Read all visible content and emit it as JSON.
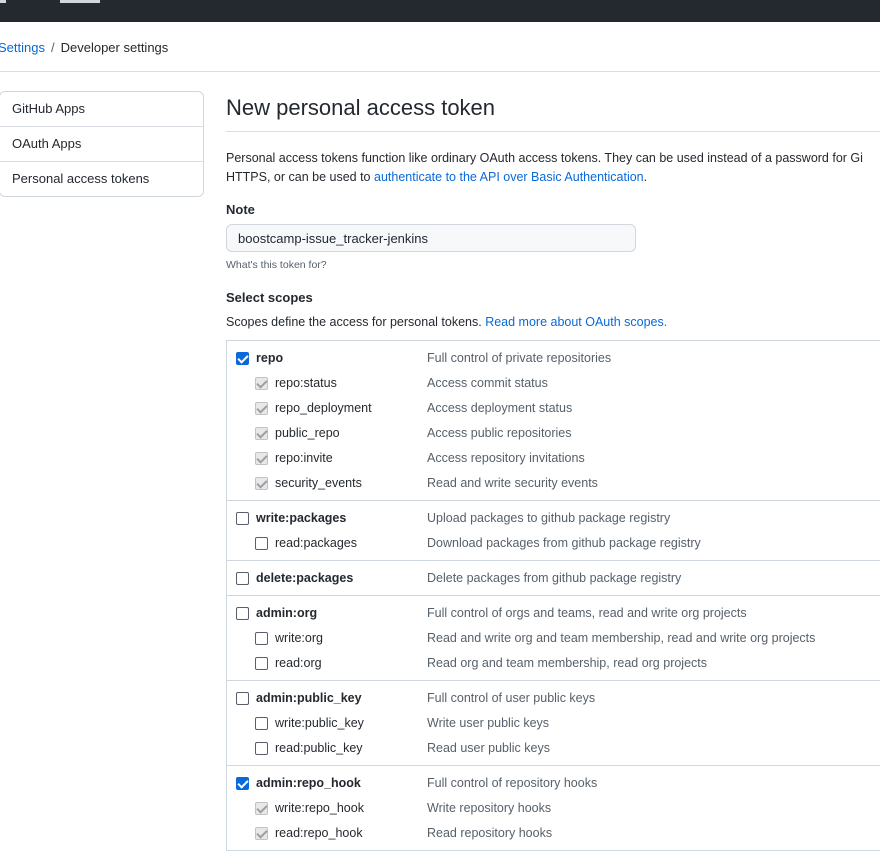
{
  "breadcrumb": {
    "parent": "Settings",
    "separator": "/",
    "current": "Developer settings"
  },
  "sidebar": {
    "items": [
      {
        "label": "GitHub Apps"
      },
      {
        "label": "OAuth Apps"
      },
      {
        "label": "Personal access tokens"
      }
    ]
  },
  "page": {
    "title": "New personal access token"
  },
  "intro": {
    "line1": "Personal access tokens function like ordinary OAuth access tokens. They can be used instead of a password for Gi",
    "line2_prefix": "HTTPS, or can be used to ",
    "line2_link": "authenticate to the API over Basic Authentication",
    "line2_suffix": "."
  },
  "note": {
    "label": "Note",
    "value": "boostcamp-issue_tracker-jenkins",
    "hint": "What's this token for?"
  },
  "scopes": {
    "label": "Select scopes",
    "description_prefix": "Scopes define the access for personal tokens. ",
    "description_link": "Read more about OAuth scopes.",
    "groups": [
      {
        "name": "repo",
        "description": "Full control of private repositories",
        "checked": true,
        "children": [
          {
            "name": "repo:status",
            "description": "Access commit status",
            "checked": true,
            "disabled": true
          },
          {
            "name": "repo_deployment",
            "description": "Access deployment status",
            "checked": true,
            "disabled": true
          },
          {
            "name": "public_repo",
            "description": "Access public repositories",
            "checked": true,
            "disabled": true
          },
          {
            "name": "repo:invite",
            "description": "Access repository invitations",
            "checked": true,
            "disabled": true
          },
          {
            "name": "security_events",
            "description": "Read and write security events",
            "checked": true,
            "disabled": true
          }
        ]
      },
      {
        "name": "write:packages",
        "description": "Upload packages to github package registry",
        "checked": false,
        "children": [
          {
            "name": "read:packages",
            "description": "Download packages from github package registry",
            "checked": false,
            "disabled": false
          }
        ]
      },
      {
        "name": "delete:packages",
        "description": "Delete packages from github package registry",
        "checked": false,
        "children": []
      },
      {
        "name": "admin:org",
        "description": "Full control of orgs and teams, read and write org projects",
        "checked": false,
        "children": [
          {
            "name": "write:org",
            "description": "Read and write org and team membership, read and write org projects",
            "checked": false,
            "disabled": false
          },
          {
            "name": "read:org",
            "description": "Read org and team membership, read org projects",
            "checked": false,
            "disabled": false
          }
        ]
      },
      {
        "name": "admin:public_key",
        "description": "Full control of user public keys",
        "checked": false,
        "children": [
          {
            "name": "write:public_key",
            "description": "Write user public keys",
            "checked": false,
            "disabled": false
          },
          {
            "name": "read:public_key",
            "description": "Read user public keys",
            "checked": false,
            "disabled": false
          }
        ]
      },
      {
        "name": "admin:repo_hook",
        "description": "Full control of repository hooks",
        "checked": true,
        "children": [
          {
            "name": "write:repo_hook",
            "description": "Write repository hooks",
            "checked": true,
            "disabled": true
          },
          {
            "name": "read:repo_hook",
            "description": "Read repository hooks",
            "checked": true,
            "disabled": true
          }
        ]
      }
    ]
  },
  "colors": {
    "header_bg": "#24292f",
    "link": "#0969da",
    "checkbox_checked": "#0969da",
    "border": "#d0d7de",
    "muted_text": "#57606a"
  }
}
